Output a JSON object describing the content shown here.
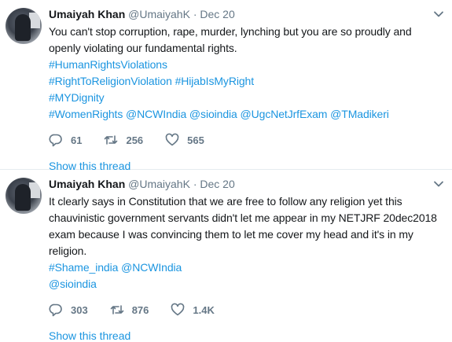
{
  "tweets": [
    {
      "author": {
        "name": "Umaiyah Khan",
        "handle": "@UmaiyahK"
      },
      "separator": "·",
      "date": "Dec 20",
      "text_lines": [
        "You can't stop corruption, rape, murder, lynching but you are so proudly and",
        "openly violating our fundamental rights."
      ],
      "link_lines": [
        "#HumanRightsViolations",
        "#RightToReligionViolation #HijabIsMyRight",
        "#MYDignity",
        "#WomenRights @NCWIndia @sioindia @UgcNetJrfExam @TMadikeri"
      ],
      "replies": "61",
      "retweets": "256",
      "likes": "565",
      "thread_link": "Show this thread"
    },
    {
      "author": {
        "name": "Umaiyah Khan",
        "handle": "@UmaiyahK"
      },
      "separator": "·",
      "date": "Dec 20",
      "text_lines": [
        "It clearly says in Constitution that we are free to follow any religion yet this",
        "chauvinistic government servants didn't let me appear in my NETJRF 20dec2018",
        "exam because I was convincing them to let me cover my head and it's in my",
        "religion."
      ],
      "link_lines": [
        "#Shame_india @NCWIndia",
        "@sioindia"
      ],
      "replies": "303",
      "retweets": "876",
      "likes": "1.4K",
      "thread_link": "Show this thread"
    }
  ],
  "icons": {
    "reply": "reply-icon",
    "retweet": "retweet-icon",
    "like": "heart-icon",
    "more": "chevron-down-icon"
  },
  "colors": {
    "link": "#1b95e0",
    "secondary": "#657786",
    "text": "#14171a",
    "divider": "#e6ecf0"
  }
}
